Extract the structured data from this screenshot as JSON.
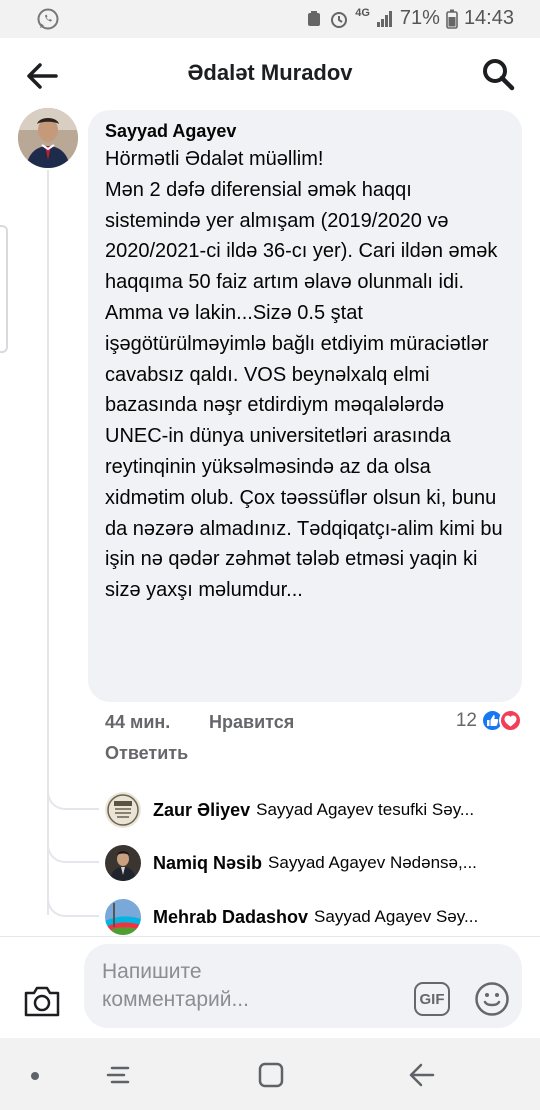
{
  "status_bar": {
    "notification_icon": "whatsapp-icon",
    "network": "4G",
    "battery": "71%",
    "time": "14:43"
  },
  "header": {
    "title": "Ədalət Muradov"
  },
  "comment": {
    "author": "Sayyad Agayev",
    "text": "Hörmətli Ədalət müəllim!\nMən 2 dəfə diferensial əmək haqqı sistemində yer almışam (2019/2020 və 2020/2021-ci ildə 36-cı yer). Cari ildən əmək haqqıma 50 faiz artım əlavə olunmalı idi. Amma və lakin...Sizə 0.5 ştat işəgötürülməyimlə bağlı etdiyim müraciətlər cavabsız qaldı. VOS beynəlxalq elmi bazasında nəşr etdirdiym məqalələrdə UNEC-in dünya universitetləri arasında reytinqinin yüksəlməsində az da olsa xidmətim olub. Çox təəssüflər olsun ki, bunu da nəzərə almadınız. Tədqiqatçı-alim kimi bu işin nə qədər zəhmət tələb etməsi yaqin ki sizə yaxşı məlumdur...",
    "time": "44 мин.",
    "like_label": "Нравится",
    "reply_label": "Ответить",
    "reaction_count": "12"
  },
  "replies": [
    {
      "name": "Zaur Əliyev",
      "snippet": "Sayyad Agayev   tesufki Səy..."
    },
    {
      "name": "Namiq Nəsib",
      "snippet": "Sayyad Agayev  Nədənsə,..."
    },
    {
      "name": "Mehrab  Dadashov",
      "snippet": "Sayyad Agayev Səy..."
    }
  ],
  "composer": {
    "placeholder": "Напишите\nкомментарий...",
    "gif_label": "GIF"
  },
  "colors": {
    "like_blue": "#1877f2",
    "love_red": "#f33e58",
    "bubble_bg": "#f0f2f5"
  }
}
